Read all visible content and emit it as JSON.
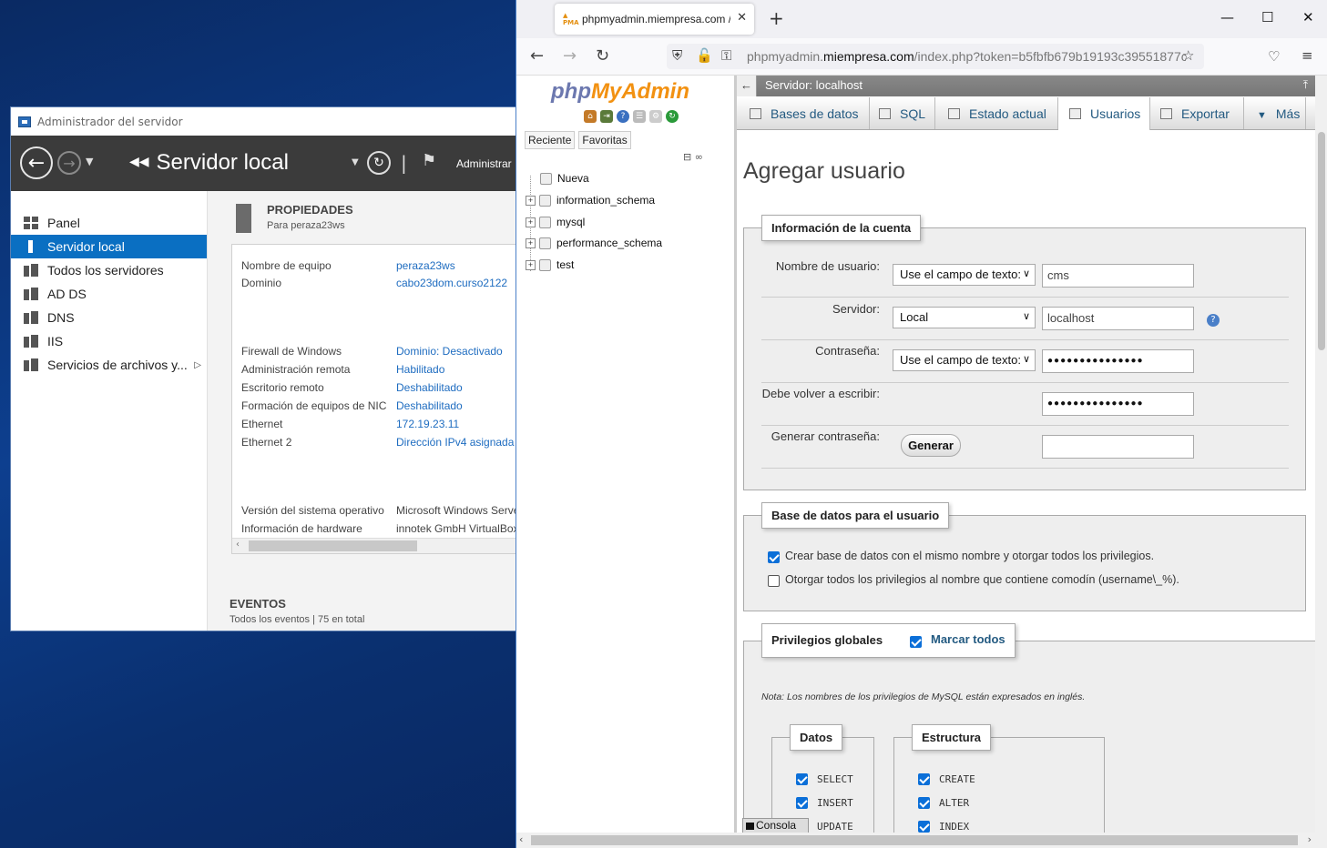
{
  "server_manager": {
    "window_title": "Administrador del servidor",
    "breadcrumb": "Servidor local",
    "admin_label": "Administrar",
    "sidebar": [
      {
        "label": "Panel",
        "icon": "dashboard-icon"
      },
      {
        "label": "Servidor local",
        "icon": "local-server-icon",
        "active": true
      },
      {
        "label": "Todos los servidores",
        "icon": "all-servers-icon"
      },
      {
        "label": "AD DS",
        "icon": "adds-icon"
      },
      {
        "label": "DNS",
        "icon": "dns-icon"
      },
      {
        "label": "IIS",
        "icon": "iis-icon"
      },
      {
        "label": "Servicios de archivos y...",
        "icon": "file-services-icon"
      }
    ],
    "properties": {
      "title": "PROPIEDADES",
      "subtitle": "Para peraza23ws",
      "rows": [
        {
          "key": "Nombre de equipo",
          "value": "peraza23ws"
        },
        {
          "key": "Dominio",
          "value": "cabo23dom.curso2122"
        },
        {
          "key": "Firewall de Windows",
          "value": "Dominio: Desactivado"
        },
        {
          "key": "Administración remota",
          "value": "Habilitado"
        },
        {
          "key": "Escritorio remoto",
          "value": "Deshabilitado"
        },
        {
          "key": "Formación de equipos de NIC",
          "value": "Deshabilitado"
        },
        {
          "key": "Ethernet",
          "value": "172.19.23.11"
        },
        {
          "key": "Ethernet 2",
          "value": "Dirección IPv4 asignada p"
        },
        {
          "key": "Versión del sistema operativo",
          "value": "Microsoft Windows Serve"
        },
        {
          "key": "Información de hardware",
          "value": "innotek GmbH VirtualBox"
        }
      ]
    },
    "events": {
      "title": "EVENTOS",
      "subtitle": "Todos los eventos | 75 en total"
    }
  },
  "browser": {
    "tab_title": "phpmyadmin.miempresa.com /",
    "url_prefix": "phpmyadmin.",
    "url_domain": "miempresa.com",
    "url_rest": "/index.php?token=b5fbfb679b19193c39551877c",
    "accent": "#0b6fd8"
  },
  "pma_nav": {
    "logo_php": "php",
    "logo_myadmin": "MyAdmin",
    "recent": "Reciente",
    "favorites": "Favoritas",
    "tree": [
      "Nueva",
      "information_schema",
      "mysql",
      "performance_schema",
      "test"
    ]
  },
  "pma_main": {
    "server_bar": "Servidor: localhost",
    "tabs": [
      "Bases de datos",
      "SQL",
      "Estado actual",
      "Usuarios",
      "Exportar",
      "Más"
    ],
    "heading": "Agregar usuario",
    "account": {
      "legend": "Información de la cuenta",
      "username_label": "Nombre de usuario:",
      "username_mode": "Use el campo de texto:",
      "username_value": "cms",
      "host_label": "Servidor:",
      "host_mode": "Local",
      "host_value": "localhost",
      "password_label": "Contraseña:",
      "password_mode": "Use el campo de texto:",
      "password_mask": "●●●●●●●●●●●●●●●",
      "retype_label": "Debe volver a escribir:",
      "retype_mask": "●●●●●●●●●●●●●●●",
      "generate_label": "Generar contraseña:",
      "generate_button": "Generar"
    },
    "database": {
      "legend": "Base de datos para el usuario",
      "opt1": "Crear base de datos con el mismo nombre y otorgar todos los privilegios.",
      "opt1_checked": true,
      "opt2": "Otorgar todos los privilegios al nombre que contiene comodín (username\\_%).",
      "opt2_checked": false
    },
    "privileges": {
      "legend": "Privilegios globales",
      "check_all": "Marcar todos",
      "note": "Nota: Los nombres de los privilegios de MySQL están expresados en inglés.",
      "data_legend": "Datos",
      "data_items": [
        "SELECT",
        "INSERT",
        "UPDATE"
      ],
      "structure_legend": "Estructura",
      "structure_items": [
        "CREATE",
        "ALTER",
        "INDEX"
      ]
    },
    "console": "Consola"
  }
}
